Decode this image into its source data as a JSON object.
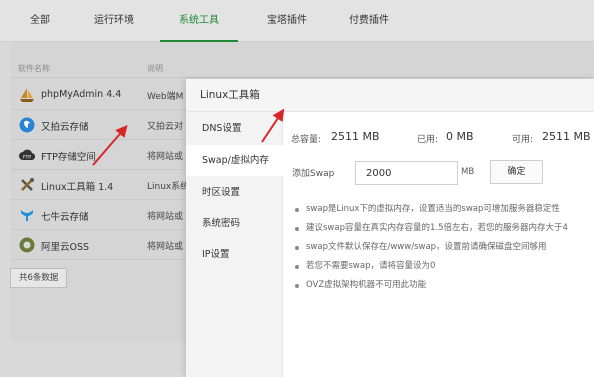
{
  "tabs": [
    {
      "label": "全部"
    },
    {
      "label": "运行环境"
    },
    {
      "label": "系统工具"
    },
    {
      "label": "宝塔插件"
    },
    {
      "label": "付费插件"
    }
  ],
  "table": {
    "headers": [
      "软件名称",
      "说明"
    ],
    "rows": [
      {
        "name": "phpMyAdmin 4.4",
        "desc": "Web端M",
        "icon": "sailboat-icon"
      },
      {
        "name": "又拍云存储",
        "desc": "又拍云对",
        "icon": "upyun-icon"
      },
      {
        "name": "FTP存储空间",
        "desc": "将网站或",
        "icon": "ftp-icon"
      },
      {
        "name": "Linux工具箱 1.4",
        "desc": "Linux系统",
        "icon": "tools-icon"
      },
      {
        "name": "七牛云存储",
        "desc": "将网站或",
        "icon": "qiniu-icon"
      },
      {
        "name": "阿里云OSS",
        "desc": "将网站或",
        "icon": "aliyun-icon"
      }
    ],
    "total": "共6条数据"
  },
  "modal": {
    "title": "Linux工具箱",
    "nav": [
      {
        "label": "DNS设置"
      },
      {
        "label": "Swap/虚拟内存"
      },
      {
        "label": "时区设置"
      },
      {
        "label": "系统密码"
      },
      {
        "label": "IP设置"
      }
    ],
    "stats": {
      "total_label": "总容量:",
      "total_value": "2511 MB",
      "used_label": "已用:",
      "used_value": "0 MB",
      "free_label": "可用:",
      "free_value": "2511 MB"
    },
    "swap": {
      "label": "添加Swap",
      "value": "2000",
      "unit": "MB",
      "button": "确定"
    },
    "notes": [
      "swap是Linux下的虚拟内存，设置适当的swap可增加服务器稳定性",
      "建议swap容量在真实内存容量的1.5倍左右，若您的服务器内存大于4",
      "swap文件默认保存在/www/swap，设置前请确保磁盘空间够用",
      "若您不需要swap，请将容量设为0",
      "OVZ虚拟架构机器不可用此功能"
    ]
  },
  "colors": {
    "accent": "#1e8a34",
    "arrow": "#d9262a"
  }
}
